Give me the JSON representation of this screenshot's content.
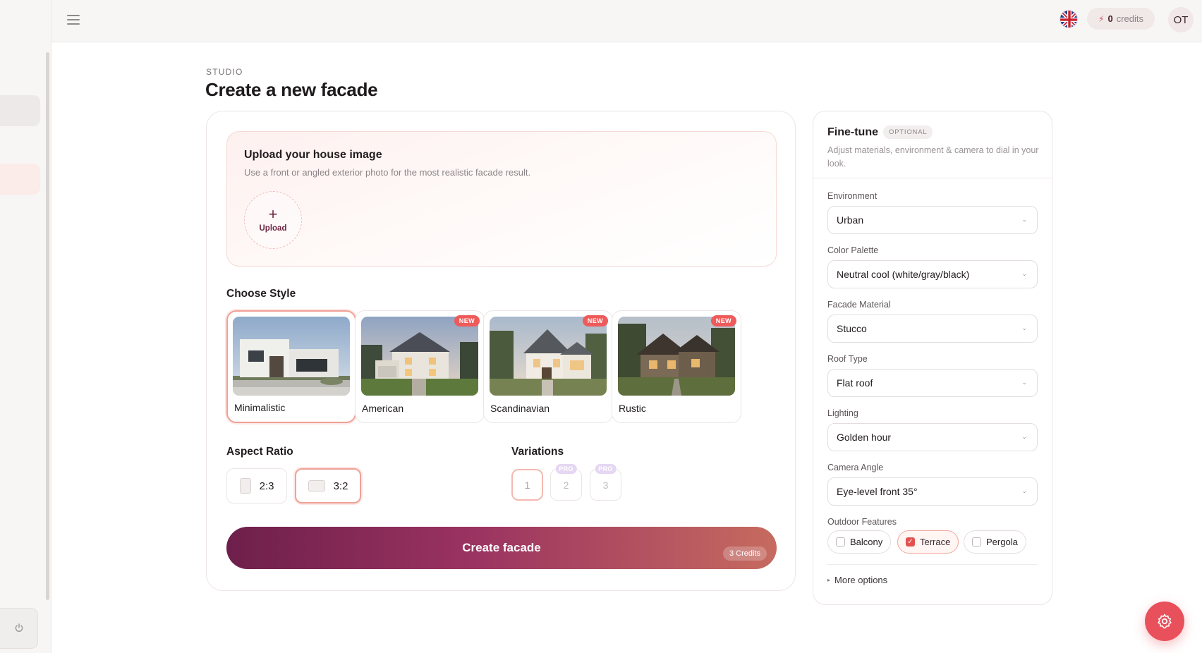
{
  "topbar": {
    "credits_value": "0",
    "credits_label": "credits",
    "avatar_initials": "OT"
  },
  "header": {
    "eyebrow": "STUDIO",
    "title": "Create a new facade"
  },
  "upload": {
    "title": "Upload your house image",
    "subtitle": "Use a front or angled exterior photo for the most realistic facade result.",
    "button_icon": "+",
    "button_label": "Upload"
  },
  "styles": {
    "label": "Choose Style",
    "items": [
      {
        "name": "Minimalistic",
        "badge": "",
        "selected": true
      },
      {
        "name": "American",
        "badge": "NEW",
        "selected": false
      },
      {
        "name": "Scandinavian",
        "badge": "NEW",
        "selected": false
      },
      {
        "name": "Rustic",
        "badge": "NEW",
        "selected": false
      }
    ]
  },
  "aspect": {
    "label": "Aspect Ratio",
    "options": [
      {
        "value": "2:3",
        "selected": false
      },
      {
        "value": "3:2",
        "selected": true
      }
    ]
  },
  "variations": {
    "label": "Variations",
    "options": [
      {
        "value": "1",
        "badge": "",
        "selected": true
      },
      {
        "value": "2",
        "badge": "PRO",
        "selected": false
      },
      {
        "value": "3",
        "badge": "PRO",
        "selected": false
      }
    ]
  },
  "create": {
    "label": "Create facade",
    "cost": "3 Credits"
  },
  "finetune": {
    "title": "Fine-tune",
    "badge": "OPTIONAL",
    "subtitle": "Adjust materials, environment & camera to dial in your look.",
    "fields": [
      {
        "label": "Environment",
        "value": "Urban"
      },
      {
        "label": "Color Palette",
        "value": "Neutral cool (white/gray/black)"
      },
      {
        "label": "Facade Material",
        "value": "Stucco"
      },
      {
        "label": "Roof Type",
        "value": "Flat roof"
      },
      {
        "label": "Lighting",
        "value": "Golden hour"
      },
      {
        "label": "Camera Angle",
        "value": "Eye-level front 35°"
      }
    ],
    "features_label": "Outdoor Features",
    "features": [
      {
        "label": "Balcony",
        "checked": false
      },
      {
        "label": "Terrace",
        "checked": true
      },
      {
        "label": "Pergola",
        "checked": false
      }
    ],
    "more_options": "More options"
  },
  "icons": {
    "menu": "hamburger-icon",
    "language": "uk-flag-icon",
    "credits": "bolt-icon",
    "power": "power-icon",
    "settings": "gear-icon",
    "dropdown": "chevron-down-icon",
    "expand": "triangle-right-icon"
  },
  "colors": {
    "accent": "#e8505b",
    "brand_dark": "#6e1f4b",
    "selection_border": "#f0a197",
    "new_badge": "#ef5a5a",
    "pro_badge": "#e5d7f2"
  }
}
